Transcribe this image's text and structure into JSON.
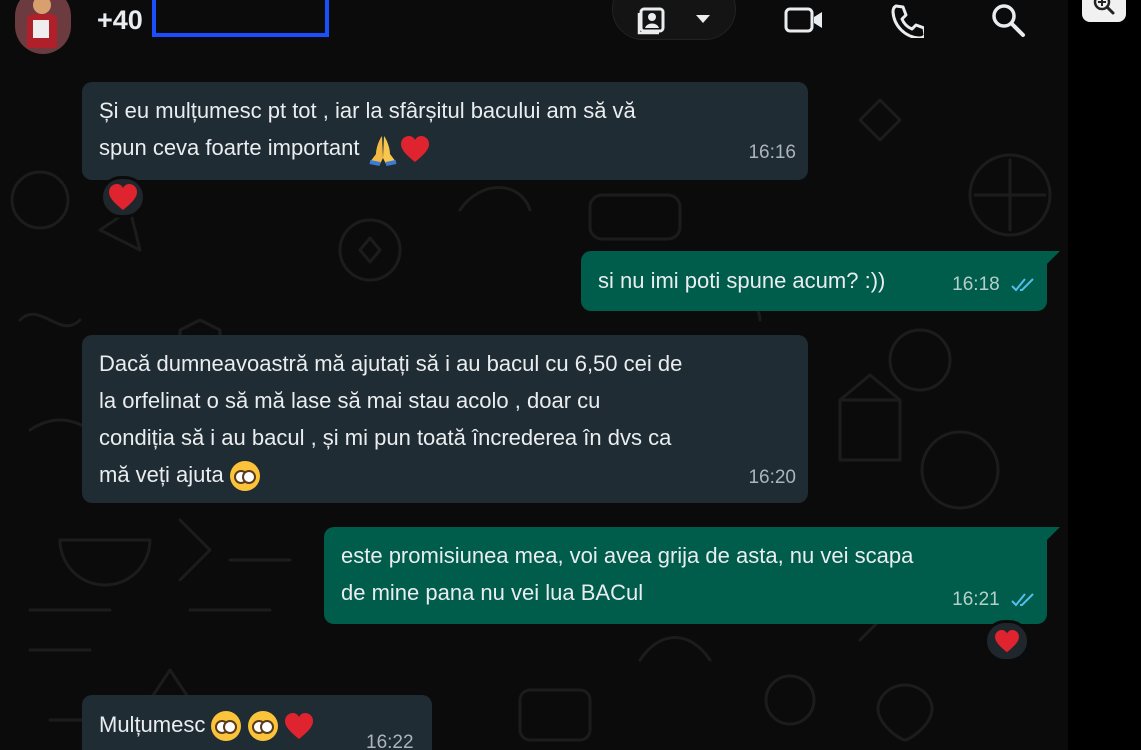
{
  "header": {
    "contact_name": "+40",
    "icons": [
      "avatar",
      "contact-card-icon",
      "chevron-down-icon",
      "video-call-icon",
      "phone-icon",
      "search-icon",
      "zoom-icon"
    ]
  },
  "messages": [
    {
      "direction": "in",
      "lines": [
        "Și eu mulțumesc pt tot , iar la sfârșitul bacului am să vă",
        "spun ceva foarte important"
      ],
      "emojis": [
        "folded-hands",
        "red-heart"
      ],
      "time": "16:16",
      "reaction": "red-heart"
    },
    {
      "direction": "out",
      "lines": [
        "si nu imi poti spune acum? :))"
      ],
      "time": "16:18",
      "status": "read"
    },
    {
      "direction": "in",
      "lines": [
        "Dacă dumneavoastră mă ajutați să i au bacul cu 6,50 cei de",
        "la orfelinat o să mă lase să mai stau acolo , doar cu",
        "condiția să i au bacul , și mi pun toată încrederea în dvs ca",
        "mă veți ajuta"
      ],
      "emojis": [
        "pleading-face"
      ],
      "time": "16:20"
    },
    {
      "direction": "out",
      "lines": [
        "este promisiunea mea, voi avea grija de asta, nu vei scapa",
        "de mine pana nu vei lua BACul"
      ],
      "time": "16:21",
      "status": "read",
      "reaction": "red-heart"
    },
    {
      "direction": "in",
      "lines": [
        "Mulțumesc"
      ],
      "emojis": [
        "pleading-face",
        "pleading-face",
        "red-heart"
      ],
      "time": "16:22"
    }
  ],
  "colors": {
    "background": "#0b0b0b",
    "incoming_bubble": "#202c33",
    "outgoing_bubble": "#005c4b",
    "read_ticks": "#53bdeb",
    "heart": "#e0242f",
    "redaction_box": "#1a4fff"
  }
}
